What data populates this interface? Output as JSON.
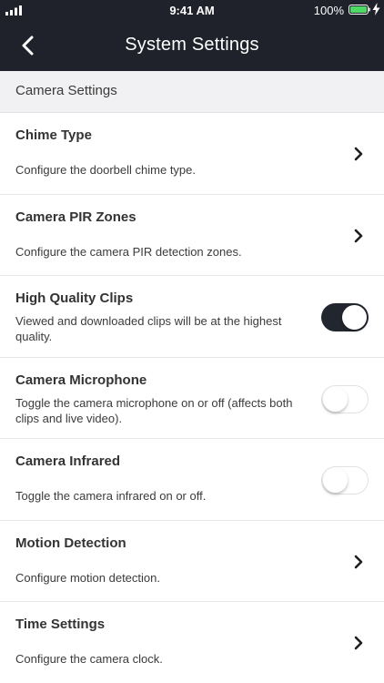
{
  "status_bar": {
    "time": "9:41 AM",
    "battery_percent": "100%",
    "icons": [
      "signal-icon",
      "battery-icon",
      "charging-bolt-icon"
    ]
  },
  "nav": {
    "title": "System Settings",
    "back_icon": "chevron-left-icon"
  },
  "section": {
    "title": "Camera Settings"
  },
  "settings": [
    {
      "title": "Chime Type",
      "description": "Configure the doorbell chime type.",
      "control": "chevron"
    },
    {
      "title": "Camera PIR Zones",
      "description": "Configure the camera PIR detection zones.",
      "control": "chevron"
    },
    {
      "title": "High Quality Clips",
      "description": "Viewed and downloaded clips will be at the highest quality.",
      "control": "toggle",
      "on": true
    },
    {
      "title": "Camera Microphone",
      "description": "Toggle the camera microphone on or off (affects both clips and live video).",
      "control": "toggle",
      "on": false
    },
    {
      "title": "Camera Infrared",
      "description": "Toggle the camera infrared on or off.",
      "control": "toggle",
      "on": false
    },
    {
      "title": "Motion Detection",
      "description": "Configure motion detection.",
      "control": "chevron"
    },
    {
      "title": "Time Settings",
      "description": "Configure the camera clock.",
      "control": "chevron"
    }
  ],
  "colors": {
    "nav_background": "#1f222a",
    "toggle_on": "#22262e",
    "battery_fill": "#4cd964",
    "section_background": "#f1f1f3"
  }
}
